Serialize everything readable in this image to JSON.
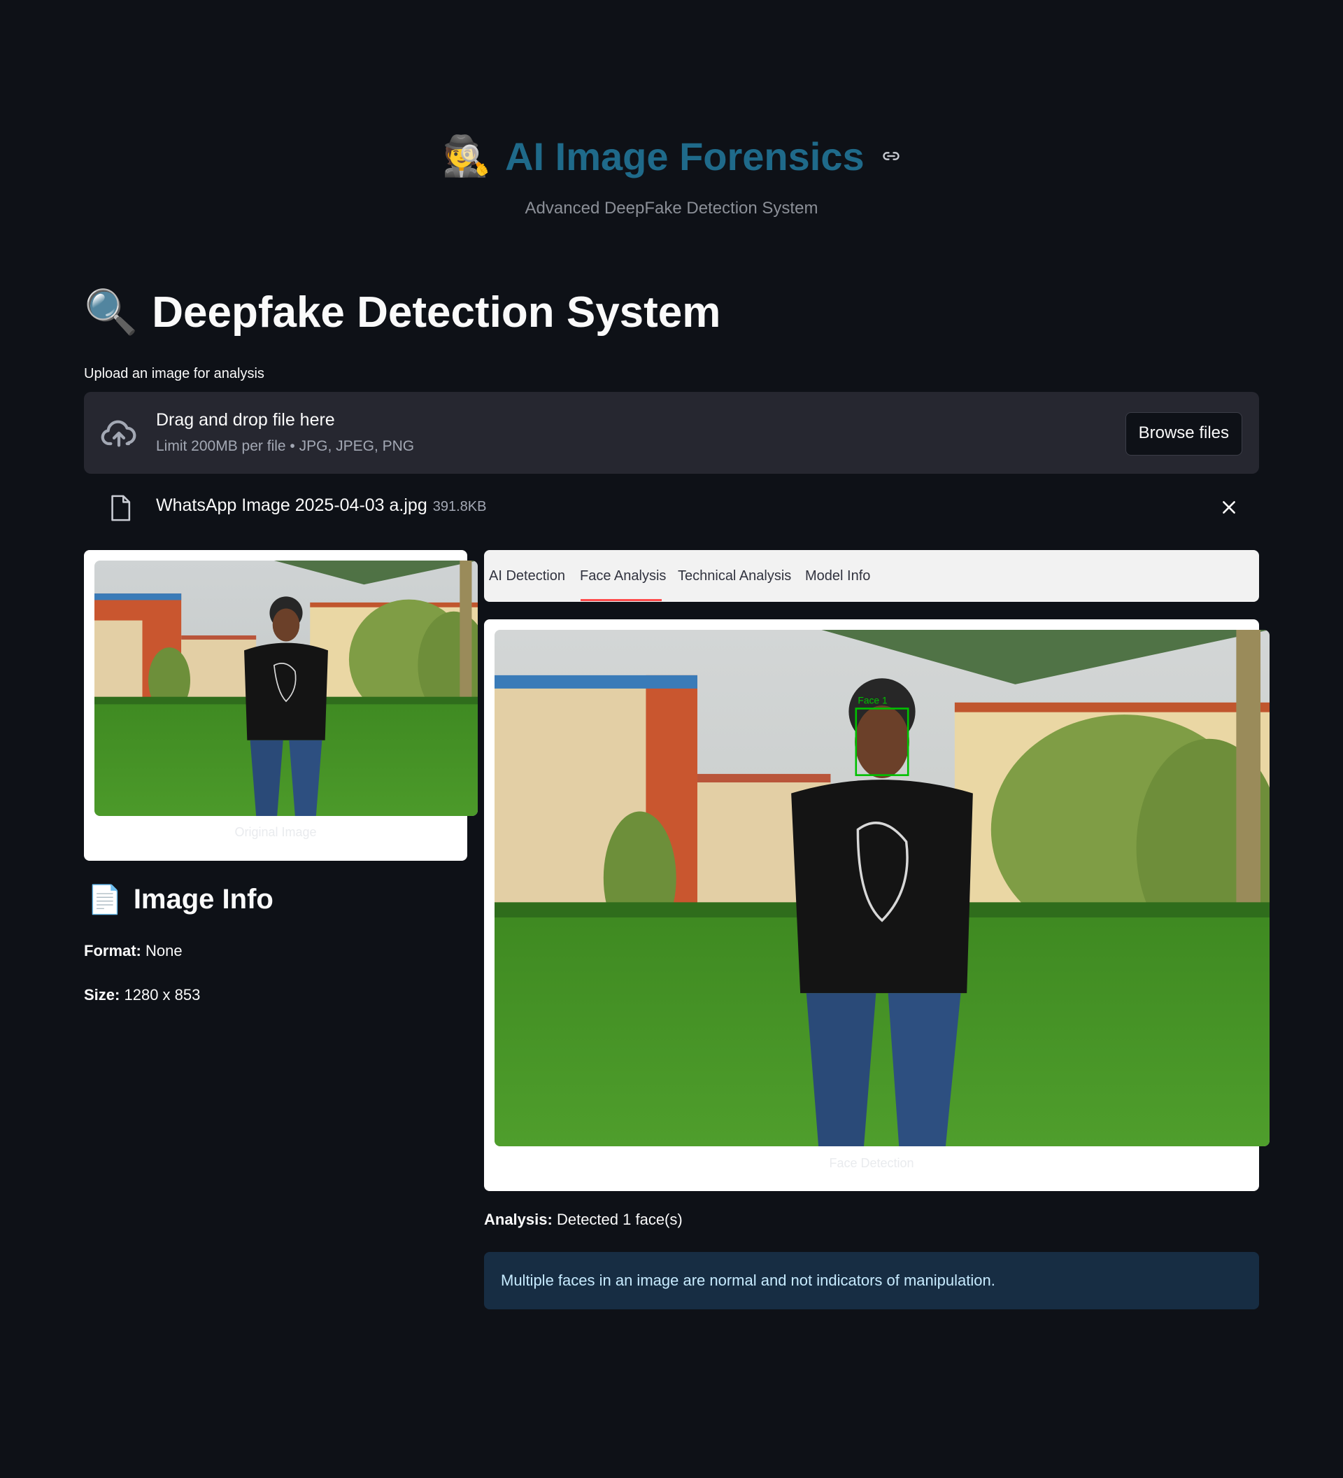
{
  "header": {
    "emoji": "🕵️",
    "title": "AI Image Forensics",
    "subtitle": "Advanced DeepFake Detection System"
  },
  "page_title": {
    "emoji": "🔍",
    "text": "Deepfake Detection System"
  },
  "uploader": {
    "label": "Upload an image for analysis",
    "drop_title": "Drag and drop file here",
    "drop_sub": "Limit 200MB per file • JPG, JPEG, PNG",
    "browse_label": "Browse files",
    "file_name": "WhatsApp Image 2025-04-03 a.jpg",
    "file_size": "391.8KB"
  },
  "left_panel": {
    "image_caption": "Original Image",
    "info_emoji": "📄",
    "info_title": "Image Info",
    "format_label": "Format:",
    "format_value": "None",
    "size_label": "Size:",
    "size_value": "1280 x 853"
  },
  "tabs": [
    {
      "label": "AI Detection"
    },
    {
      "label": "Face Analysis"
    },
    {
      "label": "Technical Analysis"
    },
    {
      "label": "Model Info"
    }
  ],
  "active_tab": "Face Analysis",
  "right_panel": {
    "image_caption": "Face Detection",
    "face_box_label": "Face 1",
    "analysis_label": "Analysis:",
    "analysis_value": "Detected 1 face(s)",
    "info_message": "Multiple faces in an image are normal and not indicators of manipulation."
  },
  "colors": {
    "background": "#0e1117",
    "title_accent": "#1f6a8a",
    "tab_indicator": "#ff4b4b",
    "info_alert_bg": "#172d43",
    "face_box": "#00c000"
  }
}
